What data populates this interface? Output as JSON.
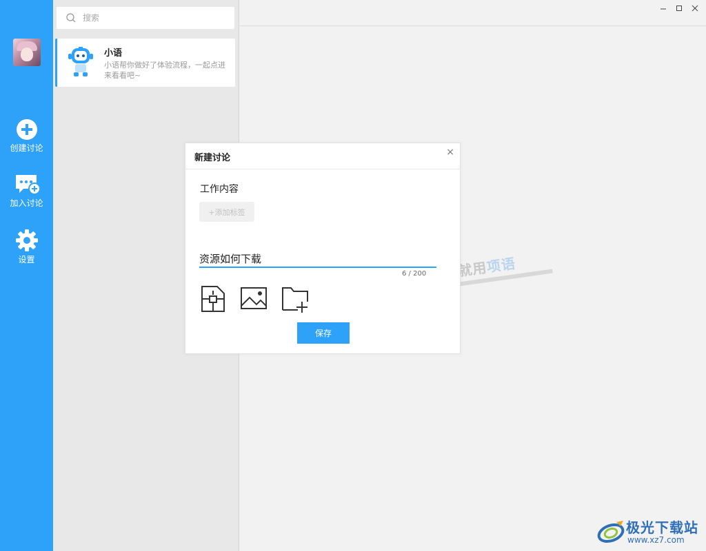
{
  "sidebar": {
    "buttons": [
      {
        "label": "创建讨论",
        "icon": "plus-circle-icon"
      },
      {
        "label": "加入讨论",
        "icon": "chat-add-icon"
      },
      {
        "label": "设置",
        "icon": "gear-icon"
      }
    ]
  },
  "search": {
    "placeholder": "搜索"
  },
  "conversations": [
    {
      "name": "小语",
      "preview": "小语帮你做好了体验流程，一起点进来看看吧~"
    }
  ],
  "watermark": {
    "prefix": "就用",
    "highlight": "项语"
  },
  "site_logo": {
    "name": "极光下载站",
    "url": "www.xz7.com"
  },
  "dialog": {
    "title": "新建讨论",
    "close": "×",
    "topic_title": "工作内容",
    "add_tag_label": "+添加标签",
    "content_value": "资源如何下载",
    "char_count": "6 / 200",
    "tools": [
      "file-icon",
      "image-icon",
      "folder-add-icon"
    ],
    "save_label": "保存"
  },
  "colors": {
    "accent": "#2ea1f8",
    "background": "#f2f2f2",
    "list_bg": "#e8e8e8"
  }
}
